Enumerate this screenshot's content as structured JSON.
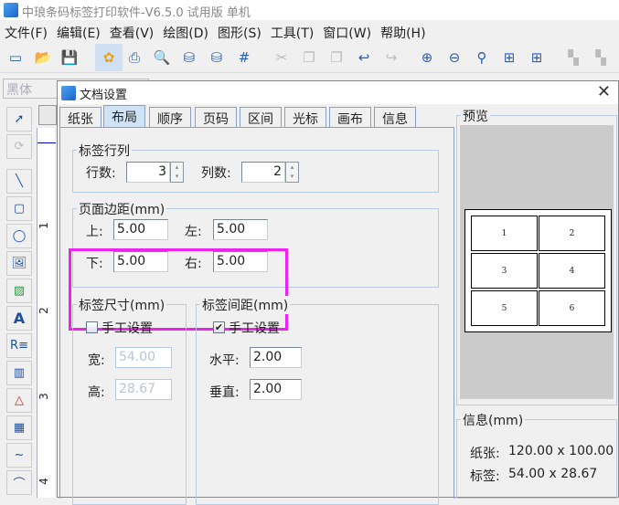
{
  "app": {
    "title": "中琅条码标签打印软件-V6.5.0 试用版 单机"
  },
  "menu": [
    "文件(F)",
    "编辑(E)",
    "查看(V)",
    "绘图(D)",
    "图形(S)",
    "工具(T)",
    "窗口(W)",
    "帮助(H)"
  ],
  "toolbar": {
    "icons": [
      "new-window-icon",
      "open-icon",
      "save-icon",
      "settings-gear-icon",
      "print-icon",
      "print-preview-icon",
      "database-icon",
      "database-connect-icon",
      "grid-icon",
      "cut-icon",
      "copy-icon",
      "paste-icon",
      "undo-icon",
      "redo-icon",
      "zoom-in-icon",
      "zoom-out-icon",
      "zoom-fit-icon",
      "fit-page-icon",
      "fit-width-icon",
      "align-left-icon",
      "align-right-icon"
    ]
  },
  "fontbar": {
    "font": "黑体"
  },
  "tools": [
    "pointer-icon",
    "rotate-icon",
    "line-icon",
    "rounded-rect-icon",
    "ellipse-icon",
    "image-icon",
    "picture-icon",
    "text-icon",
    "rich-text-icon",
    "barcode-icon",
    "shape-icon",
    "qrcode-icon",
    "curve-icon",
    "arc-icon"
  ],
  "ruler": [
    "1",
    "2",
    "3",
    "4"
  ],
  "dialog": {
    "title": "文档设置",
    "tabs": [
      "纸张",
      "布局",
      "顺序",
      "页码",
      "区间",
      "光标",
      "画布",
      "信息"
    ],
    "active_tab": "布局",
    "rowcol": {
      "legend": "标签行列",
      "rows_label": "行数:",
      "rows": "3",
      "cols_label": "列数:",
      "cols": "2"
    },
    "margins": {
      "legend": "页面边距(mm)",
      "top_label": "上:",
      "top": "5.00",
      "left_label": "左:",
      "left": "5.00",
      "bottom_label": "下:",
      "bottom": "5.00",
      "right_label": "右:",
      "right": "5.00"
    },
    "size": {
      "legend": "标签尺寸(mm)",
      "manual_label": "手工设置",
      "manual": false,
      "width_label": "宽:",
      "width": "54.00",
      "height_label": "高:",
      "height": "28.67"
    },
    "gap": {
      "legend": "标签间距(mm)",
      "manual_label": "手工设置",
      "manual": true,
      "h_label": "水平:",
      "h": "2.00",
      "v_label": "垂直:",
      "v": "2.00"
    },
    "preview": {
      "legend": "预览",
      "cells": [
        "1",
        "2",
        "3",
        "4",
        "5",
        "6"
      ]
    },
    "info": {
      "legend": "信息(mm)",
      "paper_label": "纸张:",
      "paper": "120.00 x 100.00",
      "label_label": "标签:",
      "label": "54.00 x 28.67"
    }
  },
  "colors": {
    "highlight": "#ee22ee",
    "active_tab": "#cfe2f6"
  }
}
